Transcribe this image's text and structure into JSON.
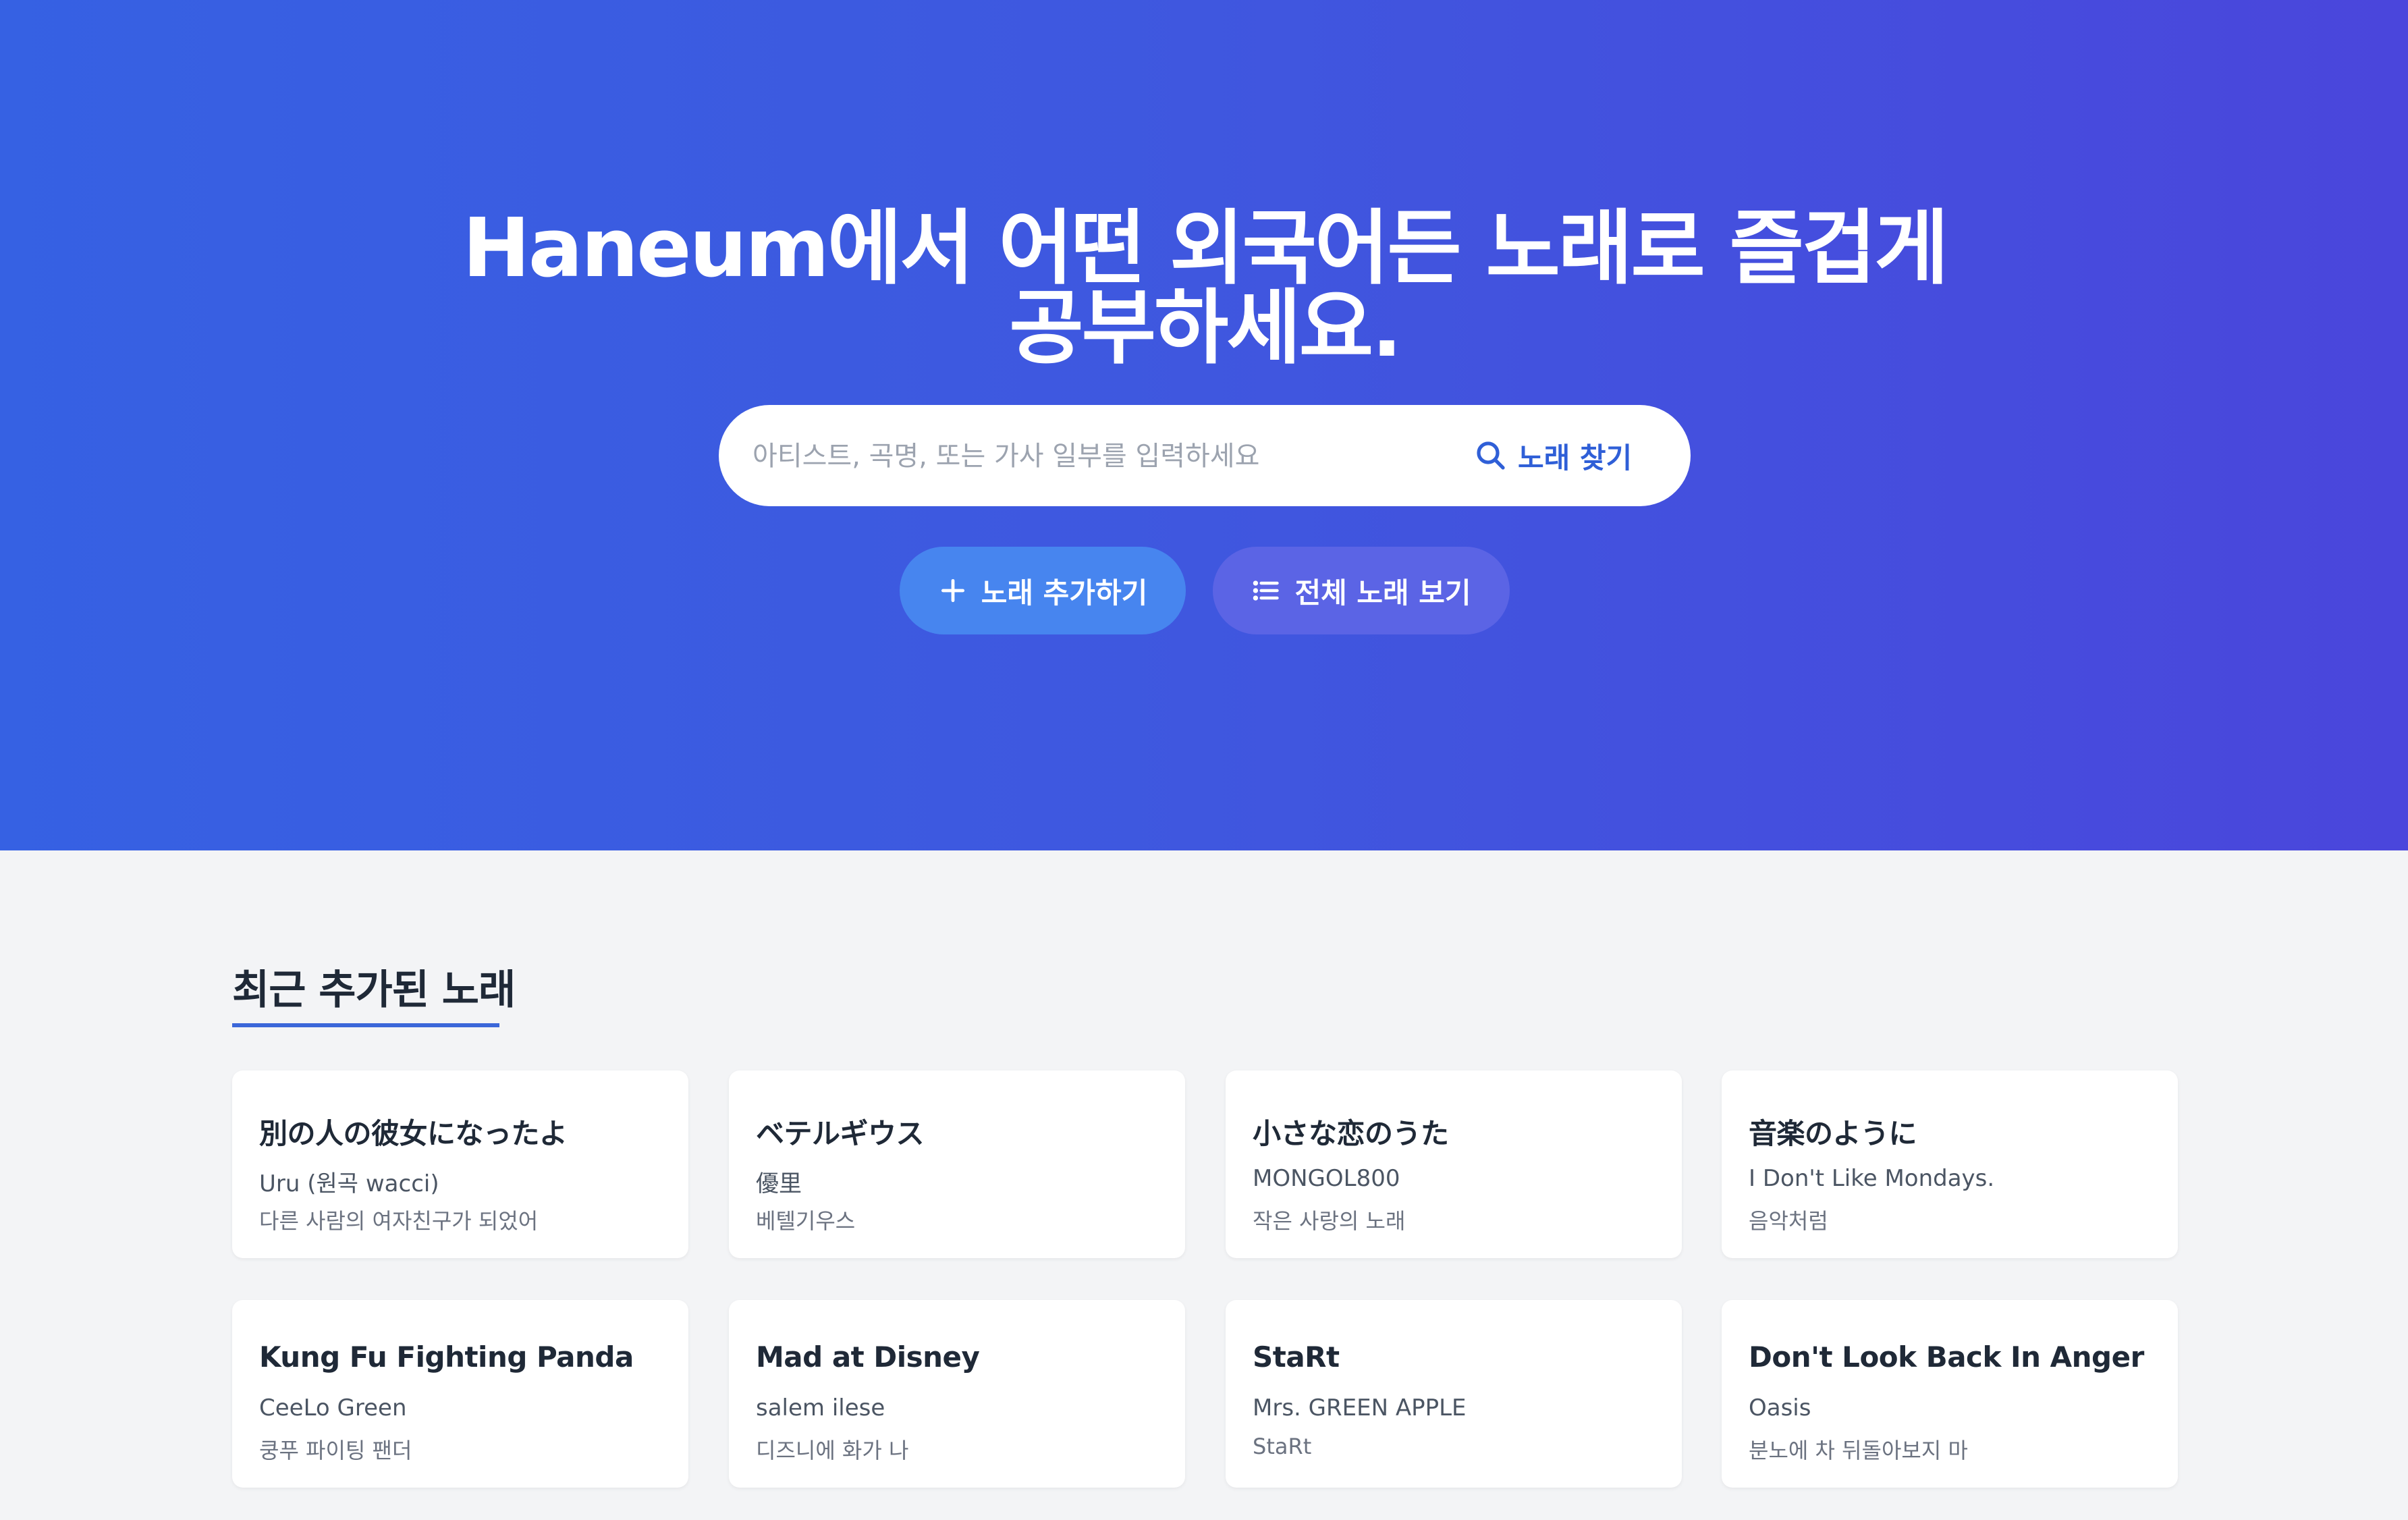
{
  "hero": {
    "title": "Haneum에서 어떤 외국어든 노래로 즐겁게 공부하세요.",
    "search_placeholder": "아티스트, 곡명, 또는 가사 일부를 입력하세요",
    "search_button": "노래 찾기",
    "add_button": "노래 추가하기",
    "list_button": "전체 노래 보기"
  },
  "recent": {
    "heading": "최근 추가된 노래",
    "songs": [
      {
        "title": "別の人の彼女になったよ",
        "artist": "Uru (원곡 wacci)",
        "subtitle": "다른 사람의 여자친구가 되었어"
      },
      {
        "title": "ベテルギウス",
        "artist": "優里",
        "subtitle": "베텔기우스"
      },
      {
        "title": "小さな恋のうた",
        "artist": "MONGOL800",
        "subtitle": "작은 사랑의 노래"
      },
      {
        "title": "音楽のように",
        "artist": "I Don't Like Mondays.",
        "subtitle": "음악처럼"
      },
      {
        "title": "Kung Fu Fighting Panda",
        "artist": "CeeLo Green",
        "subtitle": "쿵푸 파이팅 팬더"
      },
      {
        "title": "Mad at Disney",
        "artist": "salem ilese",
        "subtitle": "디즈니에 화가 나"
      },
      {
        "title": "StaRt",
        "artist": "Mrs. GREEN APPLE",
        "subtitle": "StaRt"
      },
      {
        "title": "Don't Look Back In Anger",
        "artist": "Oasis",
        "subtitle": "분노에 차 뒤돌아보지 마"
      }
    ]
  },
  "icons": {
    "search": "search-icon",
    "add": "plus-icon",
    "list": "list-icon"
  },
  "colors": {
    "hero_gradient_start": "#3661e3",
    "hero_gradient_end": "#4a46dc",
    "accent": "#2f5fd7",
    "add_button": "#4785ef",
    "list_button": "#5b64e5",
    "background": "#f3f4f6"
  }
}
